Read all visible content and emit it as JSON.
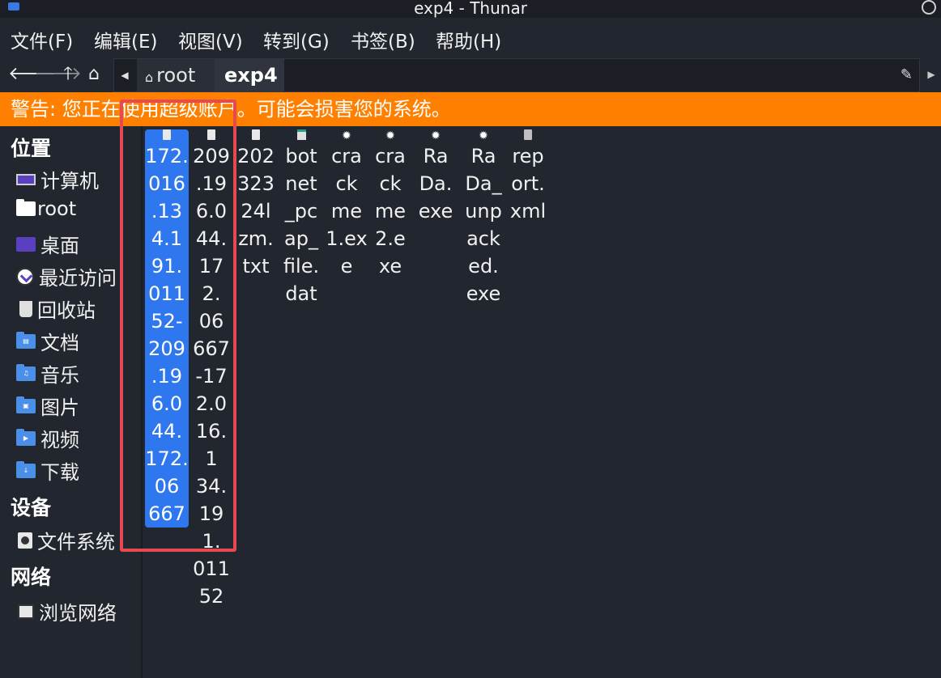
{
  "window": {
    "title": "exp4 - Thunar"
  },
  "menubar": {
    "items": [
      "文件(F)",
      "编辑(E)",
      "视图(V)",
      "转到(G)",
      "书签(B)",
      "帮助(H)"
    ]
  },
  "toolbar": {
    "back_icon": "arrow-left-icon",
    "forward_icon": "arrow-right-icon",
    "up_icon": "arrow-up-icon",
    "home_icon": "home-icon"
  },
  "pathbar": {
    "crumbs": [
      "root",
      "exp4"
    ],
    "active": "exp4"
  },
  "warning": {
    "text": "警告: 您正在使用超级账户。可能会损害您的系统。",
    "color": "#ff8000"
  },
  "sidebar": {
    "places_heading": "位置",
    "places": [
      {
        "label": "计算机",
        "icon": "computer-icon"
      },
      {
        "label": "root",
        "icon": "home-folder-icon"
      },
      {
        "label": "桌面",
        "icon": "desktop-icon"
      },
      {
        "label": "最近访问",
        "icon": "recent-icon"
      },
      {
        "label": "回收站",
        "icon": "trash-icon"
      },
      {
        "label": "文档",
        "icon": "documents-folder-icon"
      },
      {
        "label": "音乐",
        "icon": "music-folder-icon"
      },
      {
        "label": "图片",
        "icon": "pictures-folder-icon"
      },
      {
        "label": "视频",
        "icon": "videos-folder-icon"
      },
      {
        "label": "下载",
        "icon": "downloads-folder-icon"
      }
    ],
    "devices_heading": "设备",
    "devices": [
      {
        "label": "文件系统",
        "icon": "drive-icon"
      }
    ],
    "network_heading": "网络",
    "network": [
      {
        "label": "浏览网络",
        "icon": "network-icon"
      }
    ]
  },
  "files": [
    {
      "lines": [
        "172.",
        "016",
        ".13",
        "4.1",
        "91.",
        "011",
        "52-",
        "209",
        ".19",
        "6.0",
        "44.",
        "172.",
        "06",
        "667"
      ],
      "icon": "document-icon",
      "selected": true
    },
    {
      "lines": [
        "209",
        ".19",
        "6.0",
        "44.",
        "172.",
        "06",
        "667",
        "-17",
        "2.0",
        "16.1",
        "34.",
        "191.",
        "011",
        "52"
      ],
      "icon": "document-icon",
      "selected": false
    },
    {
      "lines": [
        "202",
        "323",
        "24l",
        "zm.",
        "txt"
      ],
      "icon": "text-file-icon",
      "selected": false
    },
    {
      "lines": [
        "bot",
        "net",
        "_pc",
        "ap_",
        "file.",
        "dat"
      ],
      "icon": "data-file-icon",
      "selected": false
    },
    {
      "lines": [
        "cra",
        "ck",
        "me",
        "1.ex",
        "e"
      ],
      "icon": "executable-icon",
      "selected": false
    },
    {
      "lines": [
        "cra",
        "ck",
        "me",
        "2.e",
        "xe"
      ],
      "icon": "executable-icon",
      "selected": false
    },
    {
      "lines": [
        "Ra",
        "Da.",
        "exe"
      ],
      "icon": "executable-icon",
      "selected": false
    },
    {
      "lines": [
        "Ra",
        "Da_",
        "unp",
        "ack",
        "ed.",
        "exe"
      ],
      "icon": "executable-icon",
      "selected": false
    },
    {
      "lines": [
        "rep",
        "ort.",
        "xml"
      ],
      "icon": "xml-file-icon",
      "selected": false
    }
  ],
  "colors": {
    "selection": "#2f77ef",
    "annotation": "#e8484f",
    "background": "#22262e"
  }
}
